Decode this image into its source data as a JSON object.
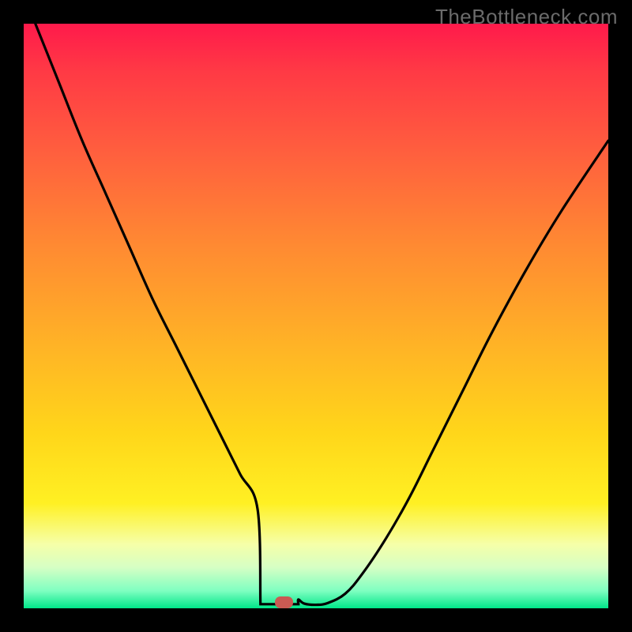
{
  "watermark": "TheBottleneck.com",
  "colors": {
    "page_bg": "#000000",
    "gradient_top": "#ff1a4b",
    "gradient_bottom": "#00e689",
    "curve": "#000000",
    "marker": "#c95a53"
  },
  "chart_data": {
    "type": "line",
    "title": "",
    "xlabel": "",
    "ylabel": "",
    "xlim": [
      0,
      100
    ],
    "ylim": [
      0,
      100
    ],
    "grid": false,
    "legend": null,
    "series": [
      {
        "name": "curve",
        "x": [
          2,
          6,
          10,
          14,
          18,
          22,
          26,
          30,
          34,
          37,
          40,
          42,
          44,
          45,
          46,
          47,
          48,
          50,
          52,
          55,
          58,
          62,
          66,
          70,
          75,
          80,
          86,
          92,
          100
        ],
        "y": [
          100,
          90,
          80,
          71,
          62,
          53,
          45,
          37,
          29,
          23,
          17,
          12,
          8,
          5,
          3,
          1.5,
          0.8,
          0.6,
          0.9,
          2.5,
          6,
          12,
          19,
          27,
          37,
          47,
          58,
          68,
          80
        ]
      }
    ],
    "flat_segment": {
      "x_start": 40.5,
      "x_end": 47,
      "y": 0.7
    },
    "marker": {
      "x": 44.5,
      "y": 1.0
    },
    "background_gradient": {
      "direction": "top-to-bottom",
      "stops": [
        {
          "pos": 0.0,
          "color": "#ff1a4b"
        },
        {
          "pos": 0.55,
          "color": "#ffd61a"
        },
        {
          "pos": 0.89,
          "color": "#f6ffa8"
        },
        {
          "pos": 1.0,
          "color": "#00e689"
        }
      ]
    }
  }
}
